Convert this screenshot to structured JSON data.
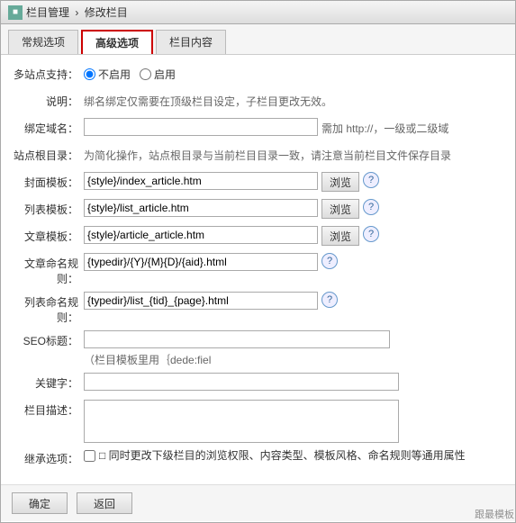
{
  "window": {
    "title_icon": "■",
    "breadcrumb": {
      "part1": "栏目管理",
      "sep": "›",
      "part2": "修改栏目"
    }
  },
  "tabs": {
    "items": [
      {
        "id": "common",
        "label": "常规选项",
        "active": false
      },
      {
        "id": "advanced",
        "label": "高级选项",
        "active": true
      },
      {
        "id": "content",
        "label": "栏目内容",
        "active": false
      }
    ]
  },
  "form": {
    "multisite_label": "多站点支持：",
    "multisite_off": "不启用",
    "multisite_on": "启用",
    "note_label": "说明：",
    "note_text": "绑名绑定仅需要在顶级栏目设定，子栏目更改无效。",
    "domain_label": "绑定域名：",
    "domain_hint": "需加 http://，一级或二级域",
    "domain_value": "",
    "rootdir_label": "站点根目录：",
    "rootdir_hint": "为简化操作，站点根目录与当前栏目目录一致，请注意当前栏目文件保存目录",
    "cover_label": "封面模板：",
    "cover_value": "{style}/index_article.htm",
    "list_label": "列表模板：",
    "list_value": "{style}/list_article.htm",
    "article_label": "文章模板：",
    "article_value": "{style}/article_article.htm",
    "article_rule_label": "文章命名规则：",
    "article_rule_value": "{typedir}/{Y}/{M}{D}/{aid}.html",
    "list_rule_label": "列表命名规则：",
    "list_rule_value": "{typedir}/list_{tid}_{page}.html",
    "seo_label": "SEO标题：",
    "seo_hint": "（栏目模板里用｛dede:fiel",
    "seo_value": "",
    "keyword_label": "关键字：",
    "keyword_value": "",
    "desc_label": "栏目描述：",
    "desc_value": "",
    "inherit_label": "继承选项：",
    "inherit_text": "□ 同时更改下级栏目的浏览权限、内容类型、模板风格、命名规则等通用属性",
    "browse_label": "浏览",
    "help_label": "?",
    "confirm_label": "确定",
    "back_label": "返回"
  },
  "watermark": "跟最模板"
}
